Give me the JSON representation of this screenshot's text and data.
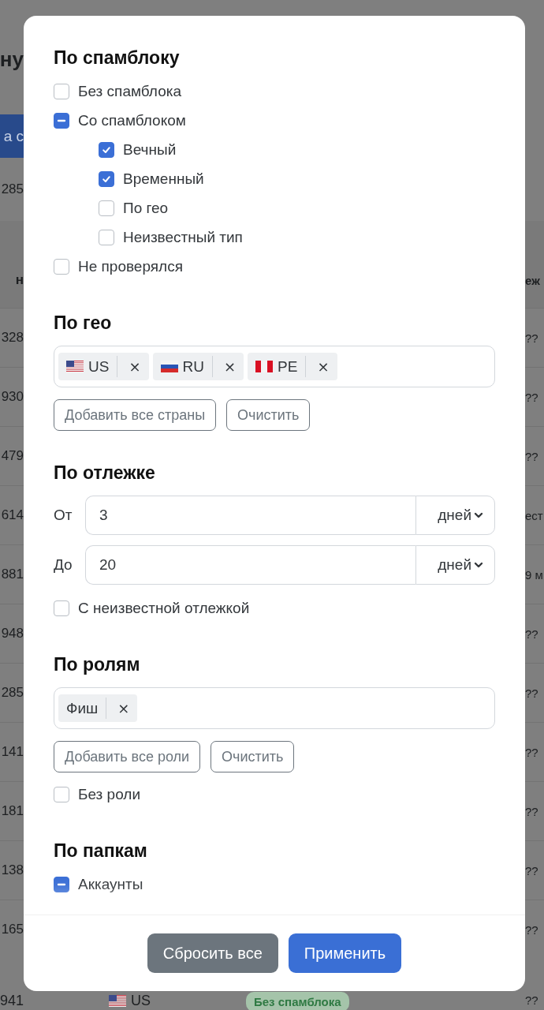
{
  "background": {
    "left_column": {
      "heading": "ну",
      "button": "а с",
      "count": "285",
      "column_header": "н",
      "cells": [
        "328",
        "930",
        "479",
        "614",
        "881",
        "948",
        "285",
        "141",
        "181",
        "138",
        "165"
      ]
    },
    "right_column": {
      "column_header": "еж",
      "cells": [
        "??",
        "??",
        "??",
        "ест",
        "9 м",
        "??",
        "??",
        "??",
        "??",
        "??",
        "??"
      ]
    },
    "bottom_row": {
      "cell_1": "941",
      "kind": "us",
      "country": "US",
      "badge": "Без спамблока",
      "cell_4": "??"
    }
  },
  "modal": {
    "sections": [
      {
        "kind": "checks",
        "title": "По спамблоку",
        "items": [
          {
            "label": "Без спамблока",
            "checked": false
          },
          {
            "label": "Со спамблоком",
            "indeterminate": true,
            "children": [
              {
                "label": "Вечный",
                "checked": true
              },
              {
                "label": "Временный",
                "checked": true
              },
              {
                "label": "По гео",
                "checked": false
              },
              {
                "label": "Неизвестный тип",
                "checked": false
              }
            ]
          },
          {
            "label": "Не проверялся",
            "checked": false
          }
        ]
      },
      {
        "kind": "tags",
        "title": "По гео",
        "tags": [
          {
            "kind": "us",
            "label": "US",
            "remove": "×"
          },
          {
            "kind": "ru",
            "label": "RU",
            "remove": "×"
          },
          {
            "kind": "pe",
            "label": "PE",
            "remove": "×"
          }
        ],
        "buttons": [
          "Добавить все страны",
          "Очистить"
        ]
      },
      {
        "kind": "range",
        "title": "По отлежке",
        "rows": [
          {
            "label": "От",
            "value": "3",
            "unit": "дней"
          },
          {
            "label": "До",
            "value": "20",
            "unit": "дней"
          }
        ],
        "items": [
          {
            "label": "С неизвестной отлежкой",
            "checked": false
          }
        ]
      },
      {
        "kind": "tags",
        "title": "По ролям",
        "tags": [
          {
            "label": "Фиш",
            "remove": "×"
          }
        ],
        "buttons": [
          "Добавить все роли",
          "Очистить"
        ],
        "items": [
          {
            "label": "Без роли",
            "checked": false
          }
        ]
      },
      {
        "kind": "checks",
        "title": "По папкам",
        "items": [
          {
            "label": "Аккаунты",
            "indeterminate": true
          }
        ]
      }
    ],
    "footer": {
      "reset_button": "Сбросить все",
      "apply_button": "Применить"
    }
  }
}
